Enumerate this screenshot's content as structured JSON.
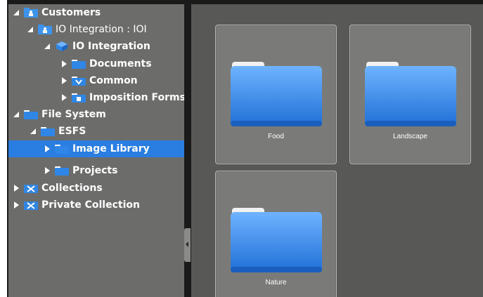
{
  "tree": {
    "items": [
      {
        "label": "Customers",
        "icon": "customer-icon",
        "expanded": true
      },
      {
        "label": "IO Integration : IOI",
        "icon": "customer-icon",
        "expanded": true
      },
      {
        "label": "IO Integration",
        "icon": "cube-icon",
        "expanded": true
      },
      {
        "label": "Documents",
        "icon": "folder-icon",
        "expanded": false
      },
      {
        "label": "Common",
        "icon": "shared-folder-icon",
        "expanded": false
      },
      {
        "label": "Imposition Forms",
        "icon": "forms-folder-icon",
        "expanded": false
      },
      {
        "label": "File System",
        "icon": "folder-icon",
        "expanded": true
      },
      {
        "label": "ESFS",
        "icon": "folder-icon",
        "expanded": true
      },
      {
        "label": "Image Library",
        "icon": "folder-icon",
        "expanded": false,
        "selected": true
      },
      {
        "label": "Projects",
        "icon": "folder-icon",
        "expanded": false
      },
      {
        "label": "Collections",
        "icon": "collection-icon",
        "expanded": false
      },
      {
        "label": "Private Collection",
        "icon": "collection-icon",
        "expanded": false
      }
    ]
  },
  "grid": {
    "items": [
      {
        "label": "Food",
        "icon": "folder-icon"
      },
      {
        "label": "Landscape",
        "icon": "folder-icon"
      },
      {
        "label": "Nature",
        "icon": "folder-icon"
      }
    ]
  },
  "colors": {
    "selection": "#2a7de1",
    "tree_background": "#6c6d6b",
    "content_background": "#585957",
    "folder_blue": "#2f86e6"
  }
}
